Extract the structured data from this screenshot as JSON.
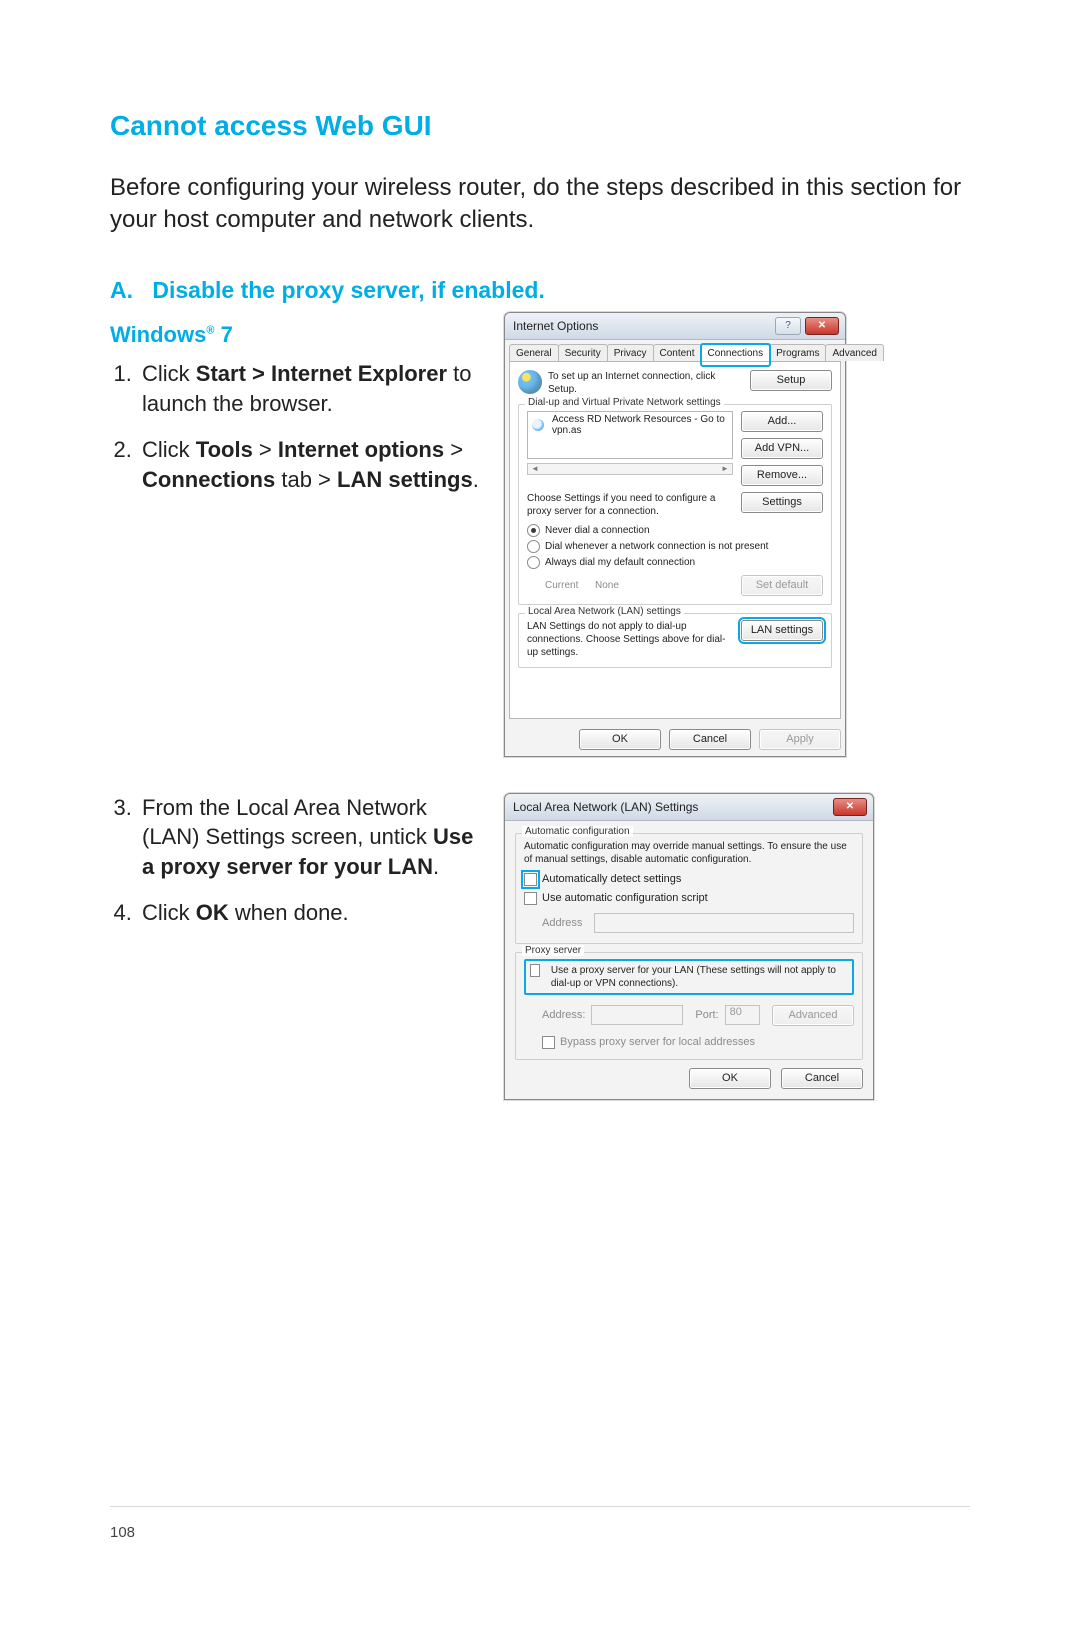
{
  "page_number": "108",
  "section_title": "Cannot access Web GUI",
  "intro": "Before configuring your wireless router, do the steps described in this section for your host computer and network clients.",
  "sub_a_label": "A.",
  "sub_a_text": "Disable the proxy server, if enabled.",
  "windows_heading": "Windows® 7",
  "steps12": {
    "s1_pre": "Click ",
    "s1_bold": "Start > Internet Explorer",
    "s1_post": " to launch the browser.",
    "s2_pre": "Click ",
    "s2_bold1": "Tools",
    "s2_mid1": " > ",
    "s2_bold2": "Internet options",
    "s2_mid2": " > ",
    "s2_bold3": "Connections",
    "s2_mid3": " tab > ",
    "s2_bold4": "LAN settings",
    "s2_post": "."
  },
  "steps34": {
    "s3_pre": "From the Local Area Network (LAN) Settings screen, untick ",
    "s3_bold": "Use a proxy server for your LAN",
    "s3_post": ".",
    "s4_pre": "Click ",
    "s4_bold": "OK",
    "s4_post": " when done."
  },
  "dlg1": {
    "title": "Internet Options",
    "tabs": [
      "General",
      "Security",
      "Privacy",
      "Content",
      "Connections",
      "Programs",
      "Advanced"
    ],
    "setup_text": "To set up an Internet connection, click Setup.",
    "setup_btn": "Setup",
    "dialup_legend": "Dial-up and Virtual Private Network settings",
    "conn_item": "Access RD Network Resources - Go to vpn.as",
    "add_btn": "Add...",
    "addvpn_btn": "Add VPN...",
    "remove_btn": "Remove...",
    "choose_text": "Choose Settings if you need to configure a proxy server for a connection.",
    "settings_btn": "Settings",
    "r_never": "Never dial a connection",
    "r_whenever": "Dial whenever a network connection is not present",
    "r_always": "Always dial my default connection",
    "current_label": "Current",
    "current_value": "None",
    "setdefault_btn": "Set default",
    "lan_legend": "Local Area Network (LAN) settings",
    "lan_text": "LAN Settings do not apply to dial-up connections. Choose Settings above for dial-up settings.",
    "lan_btn": "LAN settings",
    "ok": "OK",
    "cancel": "Cancel",
    "apply": "Apply"
  },
  "dlg2": {
    "title": "Local Area Network (LAN) Settings",
    "auto_legend": "Automatic configuration",
    "auto_text": "Automatic configuration may override manual settings.  To ensure the use of manual settings, disable automatic configuration.",
    "auto_detect": "Automatically detect settings",
    "auto_script": "Use automatic configuration script",
    "address_label": "Address",
    "proxy_legend": "Proxy server",
    "proxy_check": "Use a proxy server for your LAN (These settings will not apply to dial-up or VPN connections).",
    "addr2_label": "Address:",
    "port_label": "Port:",
    "port_value": "80",
    "advanced_btn": "Advanced",
    "bypass": "Bypass proxy server for local addresses",
    "ok": "OK",
    "cancel": "Cancel"
  }
}
